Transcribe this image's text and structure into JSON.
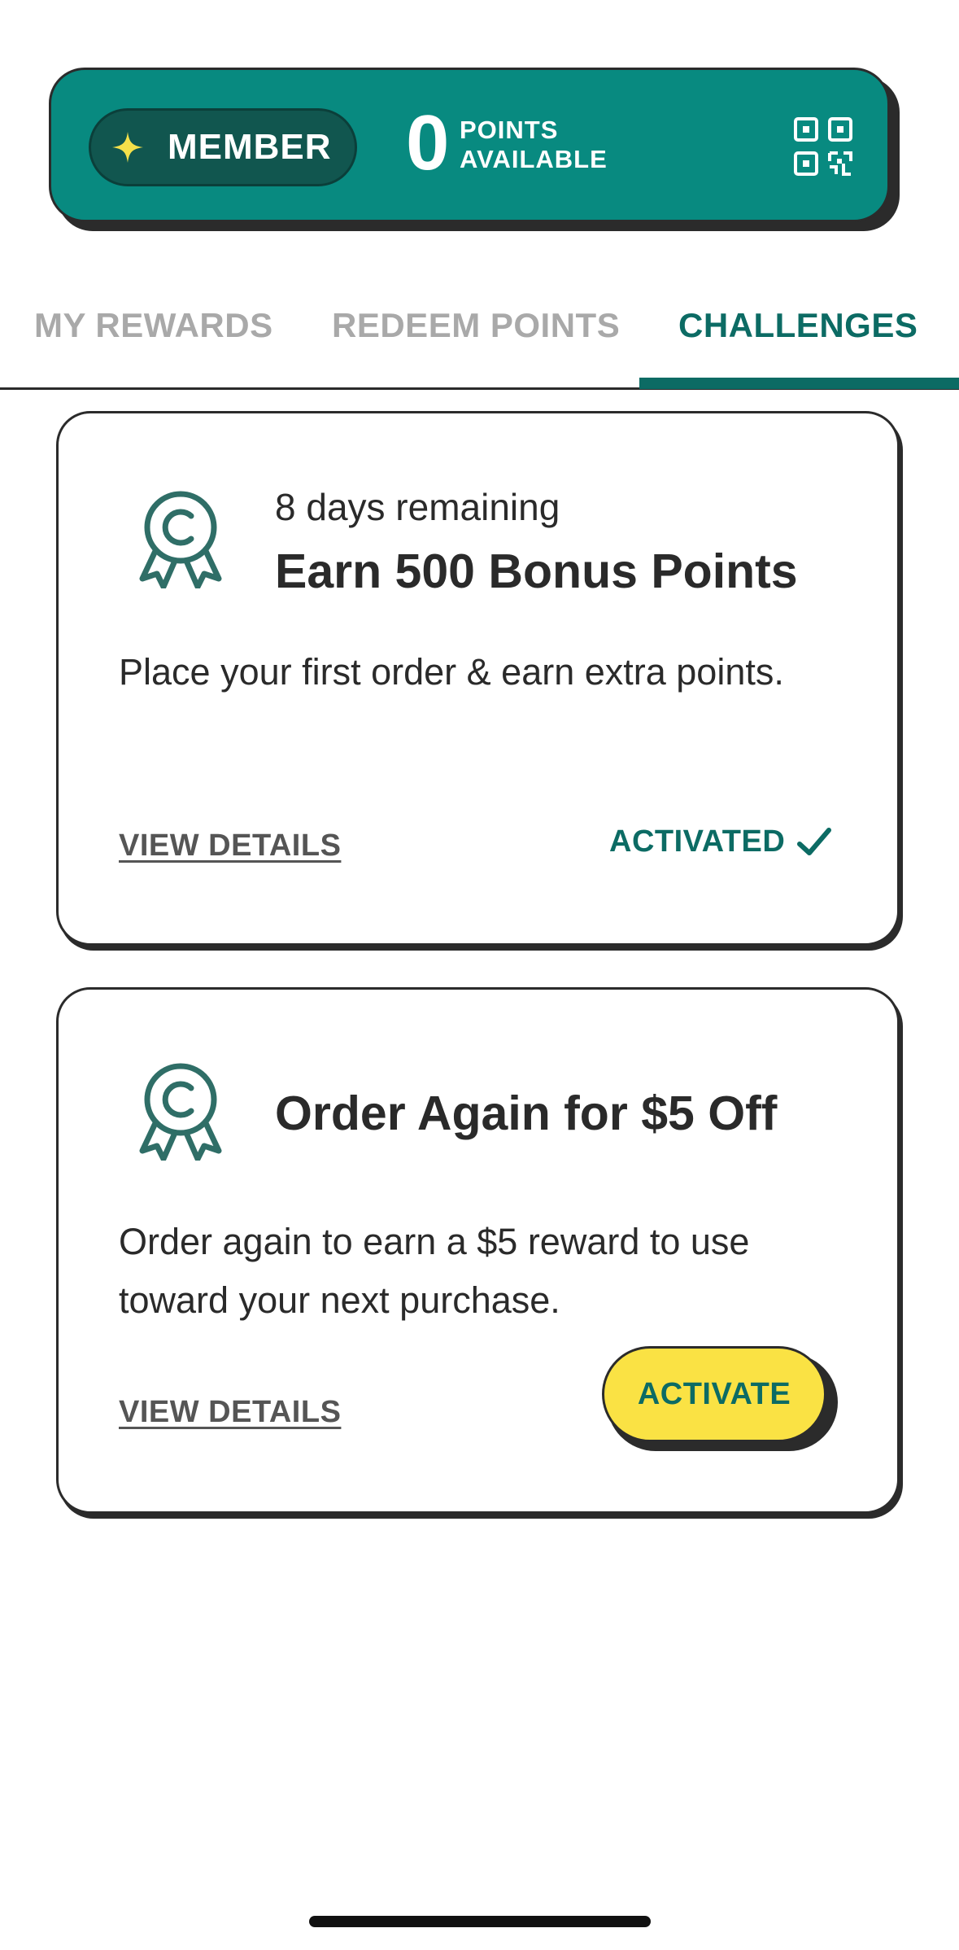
{
  "banner": {
    "member_label": "MEMBER",
    "points_value": "0",
    "points_label_line1": "POINTS",
    "points_label_line2": "AVAILABLE",
    "sparkle_icon": "sparkle-icon",
    "qr_icon": "qr-code-icon",
    "colors": {
      "background": "#088a80",
      "pill": "#11564f",
      "sparkle": "#f5e04a"
    }
  },
  "tabs": [
    {
      "label": "MY REWARDS",
      "active": false
    },
    {
      "label": "REDEEM POINTS",
      "active": false
    },
    {
      "label": "CHALLENGES",
      "active": true
    }
  ],
  "challenges": [
    {
      "remaining": "8 days remaining",
      "title": "Earn 500 Bonus Points",
      "description": "Place your first order & earn extra points.",
      "view_details": "VIEW DETAILS",
      "status": "ACTIVATED",
      "icon": "award-ribbon-icon"
    },
    {
      "remaining": "",
      "title": "Order Again for $5 Off",
      "description": "Order again to earn a $5 reward to use toward your next purchase.",
      "view_details": "VIEW DETAILS",
      "action": "ACTIVATE",
      "icon": "award-ribbon-icon"
    }
  ],
  "colors": {
    "accent": "#0c6b64",
    "button": "#fae244",
    "inactive_tab": "#a9a9a9"
  }
}
